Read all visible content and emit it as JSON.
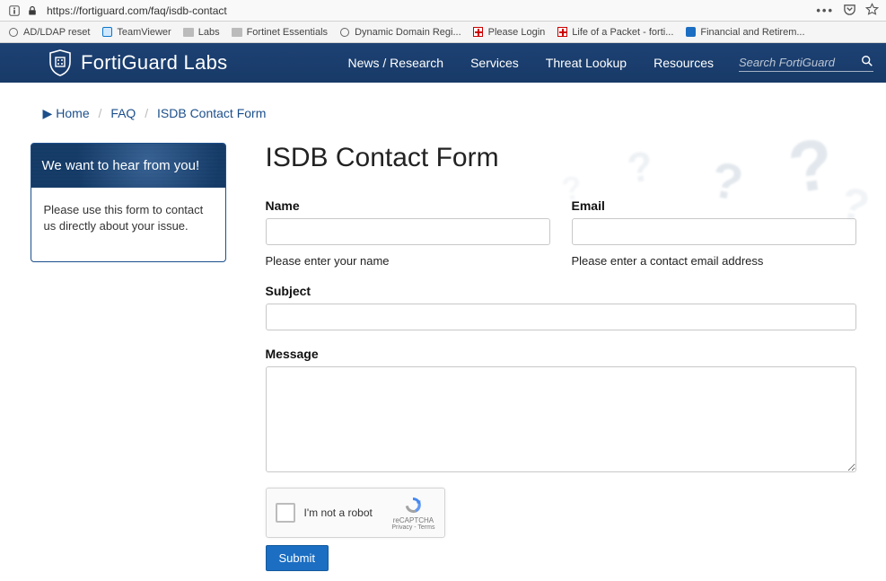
{
  "browser": {
    "url": "https://fortiguard.com/faq/isdb-contact"
  },
  "bookmarks": [
    {
      "icon": "globe",
      "label": "AD/LDAP reset"
    },
    {
      "icon": "tv",
      "label": "TeamViewer"
    },
    {
      "icon": "folder",
      "label": "Labs"
    },
    {
      "icon": "folder",
      "label": "Fortinet Essentials"
    },
    {
      "icon": "globe",
      "label": "Dynamic Domain Regi..."
    },
    {
      "icon": "red",
      "label": "Please Login"
    },
    {
      "icon": "red",
      "label": "Life of a Packet - forti..."
    },
    {
      "icon": "bluesq",
      "label": "Financial and Retirem..."
    }
  ],
  "header": {
    "brand": "FortiGuard Labs",
    "nav": [
      "News / Research",
      "Services",
      "Threat Lookup",
      "Resources"
    ],
    "search_placeholder": "Search FortiGuard"
  },
  "breadcrumb": {
    "home": "Home",
    "faq": "FAQ",
    "current": "ISDB Contact Form"
  },
  "sidecard": {
    "head": "We want to hear from you!",
    "body": "Please use this form to contact us directly about your issue."
  },
  "main": {
    "title": "ISDB Contact Form",
    "name_label": "Name",
    "name_helper": "Please enter your name",
    "email_label": "Email",
    "email_helper": "Please enter a contact email address",
    "subject_label": "Subject",
    "message_label": "Message",
    "captcha_label": "I'm not a robot",
    "captcha_brand": "reCAPTCHA",
    "captcha_links": "Privacy - Terms",
    "submit": "Submit"
  }
}
